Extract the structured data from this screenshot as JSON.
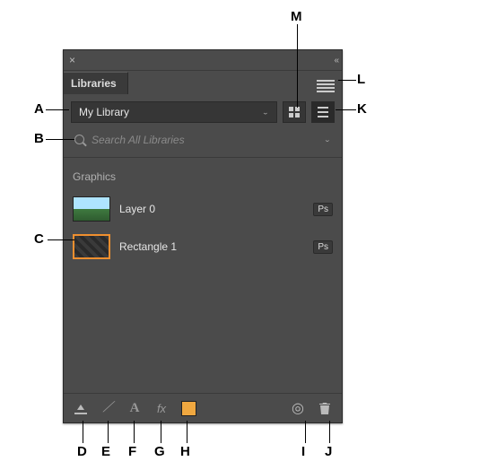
{
  "panel": {
    "tab_label": "Libraries",
    "library_selected": "My Library",
    "search_placeholder": "Search All Libraries",
    "section_title": "Graphics",
    "items": [
      {
        "name": "Layer 0",
        "badge": "Ps",
        "thumb": "landscape"
      },
      {
        "name": "Rectangle 1",
        "badge": "Ps",
        "thumb": "selected"
      }
    ],
    "swatch_color": "#f0a840"
  },
  "callouts": {
    "A": "A",
    "B": "B",
    "C": "C",
    "D": "D",
    "E": "E",
    "F": "F",
    "G": "G",
    "H": "H",
    "I": "I",
    "J": "J",
    "K": "K",
    "L": "L",
    "M": "M"
  }
}
